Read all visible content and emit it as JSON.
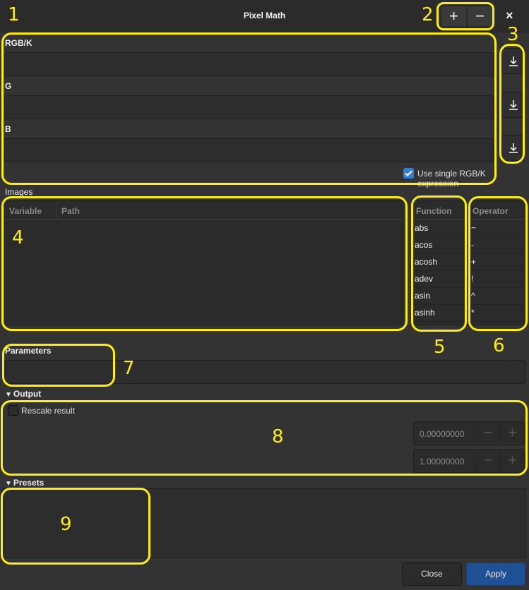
{
  "window": {
    "title": "Pixel Math",
    "add_label": "+",
    "remove_label": "−",
    "close_label": "×"
  },
  "expressions": {
    "fields": [
      {
        "label": "RGB/K",
        "value": ""
      },
      {
        "label": "G",
        "value": ""
      },
      {
        "label": "B",
        "value": ""
      }
    ],
    "use_single_label": "Use single RGB/K expression",
    "use_single_checked": true
  },
  "images": {
    "section_label": "Images",
    "columns": [
      "Variable",
      "Path"
    ],
    "rows": []
  },
  "functions": {
    "header": "Function",
    "items": [
      "abs",
      "acos",
      "acosh",
      "adev",
      "asin",
      "asinh"
    ]
  },
  "operators": {
    "header": "Operator",
    "items": [
      "~",
      "-",
      "+",
      "!",
      "^",
      "*"
    ]
  },
  "parameters": {
    "label": "Parameters",
    "value": ""
  },
  "output": {
    "section_label": "Output",
    "rescale_label": "Rescale result",
    "rescale_checked": false,
    "min_value": "0.00000000",
    "max_value": "1.00000000"
  },
  "presets": {
    "section_label": "Presets"
  },
  "footer": {
    "close_label": "Close",
    "apply_label": "Apply"
  },
  "annotations": [
    "1",
    "2",
    "3",
    "4",
    "5",
    "6",
    "7",
    "8",
    "9"
  ],
  "colors": {
    "accent": "#1f4f95",
    "checkbox": "#2f7fd8",
    "annotation": "#ffef00"
  }
}
